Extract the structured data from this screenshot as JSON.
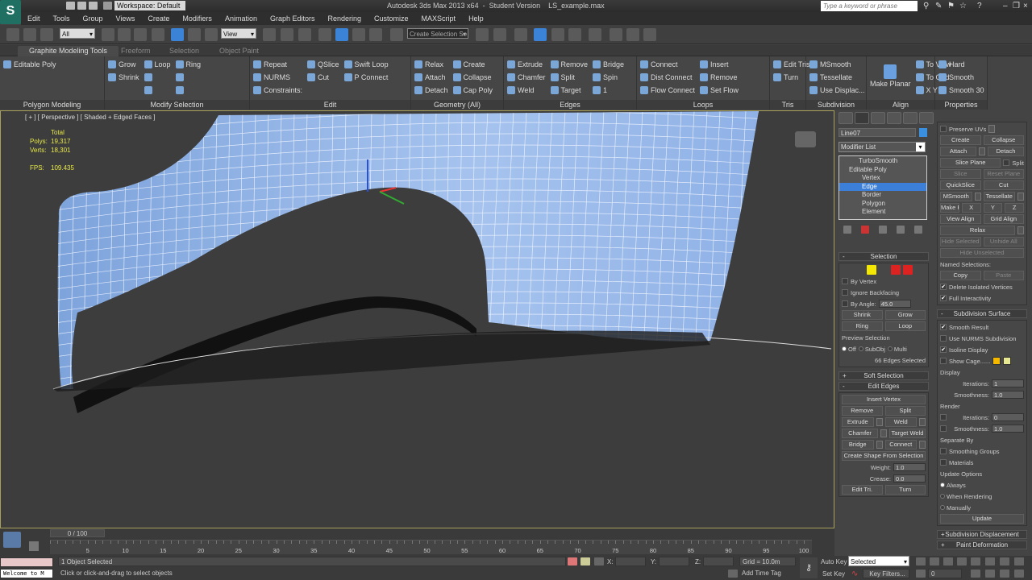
{
  "title": {
    "workspace": "Workspace: Default",
    "app_title": "Autodesk 3ds Max 2013 x64  -  Student Version    LS_example.max",
    "search_placeholder": "Type a keyword or phrase"
  },
  "menu": [
    "Edit",
    "Tools",
    "Group",
    "Views",
    "Create",
    "Modifiers",
    "Animation",
    "Graph Editors",
    "Rendering",
    "Customize",
    "MAXScript",
    "Help"
  ],
  "toolbar": {
    "selection_filter": "All",
    "ref_coord": "View",
    "named_selection": "Create Selection Se"
  },
  "ribbon_tabs": [
    {
      "label": "Graphite Modeling Tools",
      "active": true
    },
    {
      "label": "Freeform",
      "active": false
    },
    {
      "label": "Selection",
      "active": false
    },
    {
      "label": "Object Paint",
      "active": false
    }
  ],
  "ribbon_groups": [
    {
      "label": "Polygon Modeling",
      "cols": [
        [
          {
            "label": "Editable Poly"
          }
        ]
      ]
    },
    {
      "label": "Modify Selection",
      "cols": [
        [
          {
            "label": "Grow"
          },
          {
            "label": "Shrink"
          }
        ],
        [
          {
            "label": "Loop"
          },
          {
            "label": ""
          },
          {
            "label": ""
          }
        ],
        [
          {
            "label": "Ring"
          },
          {
            "label": ""
          },
          {
            "label": ""
          }
        ]
      ]
    },
    {
      "label": "Edit",
      "cols": [
        [
          {
            "label": "Repeat"
          },
          {
            "label": "NURMS"
          },
          {
            "label": "Constraints:"
          }
        ],
        [
          {
            "label": "QSlice"
          },
          {
            "label": "Cut"
          }
        ],
        [
          {
            "label": "Swift Loop"
          },
          {
            "label": "P Connect"
          }
        ]
      ]
    },
    {
      "label": "Geometry (All)",
      "cols": [
        [
          {
            "label": "Relax"
          },
          {
            "label": "Attach"
          },
          {
            "label": "Detach"
          }
        ],
        [
          {
            "label": "Create"
          },
          {
            "label": "Collapse"
          },
          {
            "label": "Cap Poly"
          }
        ]
      ]
    },
    {
      "label": "Edges",
      "cols": [
        [
          {
            "label": "Extrude"
          },
          {
            "label": "Chamfer"
          },
          {
            "label": "Weld"
          }
        ],
        [
          {
            "label": "Remove"
          },
          {
            "label": "Split"
          },
          {
            "label": "Target"
          }
        ],
        [
          {
            "label": "Bridge"
          },
          {
            "label": "Spin"
          },
          {
            "label": "1"
          }
        ]
      ]
    },
    {
      "label": "Loops",
      "cols": [
        [
          {
            "label": "Connect"
          },
          {
            "label": "Dist Connect"
          },
          {
            "label": "Flow Connect"
          }
        ],
        [
          {
            "label": "Insert"
          },
          {
            "label": "Remove"
          },
          {
            "label": "Set Flow"
          }
        ]
      ]
    },
    {
      "label": "Tris",
      "cols": [
        [
          {
            "label": "Edit Tris"
          },
          {
            "label": "Turn"
          }
        ]
      ]
    },
    {
      "label": "Subdivision",
      "cols": [
        [
          {
            "label": "MSmooth"
          },
          {
            "label": "Tessellate"
          },
          {
            "label": "Use Displac..."
          }
        ]
      ]
    },
    {
      "label": "Align",
      "cols": [
        [
          {
            "label": "Make Planar",
            "big": true
          }
        ],
        [
          {
            "label": "To View"
          },
          {
            "label": "To Grid"
          },
          {
            "label": "X  Y  Z"
          }
        ]
      ]
    },
    {
      "label": "Properties",
      "cols": [
        [
          {
            "label": "Hard"
          },
          {
            "label": "Smooth"
          },
          {
            "label": "Smooth 30"
          }
        ]
      ]
    }
  ],
  "viewport": {
    "label": "[ + ] [ Perspective ] [ Shaded + Edged Faces ]",
    "stats": {
      "total_label": "Total",
      "polys_label": "Polys:",
      "polys": "19,317",
      "verts_label": "Verts:",
      "verts": "18,301",
      "fps_label": "FPS:",
      "fps": "109.435"
    },
    "mesh_color": "#8fb1e6"
  },
  "command_panel": {
    "object_name": "Line07",
    "object_color": "#3b8fdf",
    "modifier_list": "Modifier List",
    "stack": [
      {
        "label": "TurboSmooth",
        "level": 0,
        "selected": false
      },
      {
        "label": "Editable Poly",
        "level": 0,
        "selected": false
      },
      {
        "label": "Vertex",
        "level": 1,
        "selected": false
      },
      {
        "label": "Edge",
        "level": 1,
        "selected": true
      },
      {
        "label": "Border",
        "level": 1,
        "selected": false
      },
      {
        "label": "Polygon",
        "level": 1,
        "selected": false
      },
      {
        "label": "Element",
        "level": 1,
        "selected": false
      }
    ],
    "left": [
      {
        "header": "Selection",
        "pm": "-",
        "rows": [
          [
            {
              "t": "icons"
            }
          ],
          [
            {
              "t": "chk",
              "label": "By Vertex",
              "checked": false
            }
          ],
          [
            {
              "t": "chk",
              "label": "Ignore Backfacing",
              "checked": false
            }
          ],
          [
            {
              "t": "chk",
              "label": "By Angle:",
              "checked": false
            },
            {
              "t": "spin",
              "value": "45.0"
            }
          ],
          [
            {
              "t": "btn",
              "label": "Shrink"
            },
            {
              "t": "btn",
              "label": "Grow"
            }
          ],
          [
            {
              "t": "btn",
              "label": "Ring"
            },
            {
              "t": "btn",
              "label": "Loop"
            }
          ],
          [
            {
              "t": "lbl",
              "label": "Preview Selection"
            }
          ],
          [
            {
              "t": "radio",
              "label": "Off",
              "on": true
            },
            {
              "t": "radio",
              "label": "SubObj",
              "on": false
            },
            {
              "t": "radio",
              "label": "Multi",
              "on": false
            }
          ],
          [
            {
              "t": "lblr",
              "label": "66 Edges Selected"
            }
          ]
        ]
      },
      {
        "header": "Soft Selection",
        "pm": "+",
        "rows": []
      },
      {
        "header": "Edit Edges",
        "pm": "-",
        "rows": [
          [
            {
              "t": "btn",
              "label": "Insert Vertex"
            }
          ],
          [
            {
              "t": "btn",
              "label": "Remove"
            },
            {
              "t": "btn",
              "label": "Split"
            }
          ],
          [
            {
              "t": "btn",
              "label": "Extrude"
            },
            {
              "t": "opt"
            },
            {
              "t": "btn",
              "label": "Weld"
            },
            {
              "t": "opt"
            }
          ],
          [
            {
              "t": "btn",
              "label": "Chamfer"
            },
            {
              "t": "opt"
            },
            {
              "t": "btn",
              "label": "Target Weld"
            }
          ],
          [
            {
              "t": "btn",
              "label": "Bridge"
            },
            {
              "t": "opt"
            },
            {
              "t": "btn",
              "label": "Connect"
            },
            {
              "t": "opt"
            }
          ],
          [
            {
              "t": "btn",
              "label": "Create Shape From Selection"
            }
          ],
          [
            {
              "t": "lblr",
              "label": "Weight:"
            },
            {
              "t": "spin",
              "value": "1.0"
            }
          ],
          [
            {
              "t": "lblr",
              "label": "Crease:"
            },
            {
              "t": "spin",
              "value": "0.0"
            }
          ],
          [
            {
              "t": "btn",
              "label": "Edit Tri."
            },
            {
              "t": "btn",
              "label": "Turn"
            }
          ]
        ]
      }
    ],
    "right": [
      {
        "header": "",
        "rows": [
          [
            {
              "t": "chk",
              "label": "Preserve UVs",
              "checked": false
            },
            {
              "t": "opt"
            }
          ],
          [
            {
              "t": "btn",
              "label": "Create"
            },
            {
              "t": "btn",
              "label": "Collapse"
            }
          ],
          [
            {
              "t": "btn",
              "label": "Attach"
            },
            {
              "t": "opt"
            },
            {
              "t": "btn",
              "label": "Detach"
            }
          ],
          [
            {
              "t": "btn",
              "label": "Slice Plane"
            },
            {
              "t": "chk",
              "label": "Split",
              "checked": false
            }
          ],
          [
            {
              "t": "btn",
              "label": "Slice",
              "dim": true
            },
            {
              "t": "btn",
              "label": "Reset Plane",
              "dim": true
            }
          ],
          [
            {
              "t": "btn",
              "label": "QuickSlice"
            },
            {
              "t": "btn",
              "label": "Cut"
            }
          ],
          [
            {
              "t": "btn",
              "label": "MSmooth"
            },
            {
              "t": "opt"
            },
            {
              "t": "btn",
              "label": "Tessellate"
            },
            {
              "t": "opt"
            }
          ],
          [
            {
              "t": "btn",
              "label": "Make Planar"
            },
            {
              "t": "btn",
              "label": "X"
            },
            {
              "t": "btn",
              "label": "Y"
            },
            {
              "t": "btn",
              "label": "Z"
            }
          ],
          [
            {
              "t": "btn",
              "label": "View Align"
            },
            {
              "t": "btn",
              "label": "Grid Align"
            }
          ],
          [
            {
              "t": "btn",
              "label": "Relax"
            },
            {
              "t": "opt"
            }
          ],
          [
            {
              "t": "btn",
              "label": "Hide Selected",
              "dim": true
            },
            {
              "t": "btn",
              "label": "Unhide All",
              "dim": true
            }
          ],
          [
            {
              "t": "btn",
              "label": "Hide Unselected",
              "dim": true
            }
          ],
          [
            {
              "t": "lbl",
              "label": "Named Selections:"
            }
          ],
          [
            {
              "t": "btn",
              "label": "Copy"
            },
            {
              "t": "btn",
              "label": "Paste",
              "dim": true
            }
          ],
          [
            {
              "t": "chk",
              "label": "Delete Isolated Vertices",
              "checked": true
            }
          ],
          [
            {
              "t": "chk",
              "label": "Full Interactivity",
              "checked": true
            }
          ]
        ]
      },
      {
        "header": "Subdivision Surface",
        "pm": "-",
        "rows": [
          [
            {
              "t": "chk",
              "label": "Smooth Result",
              "checked": true
            }
          ],
          [
            {
              "t": "chk",
              "label": "Use NURMS Subdivision",
              "checked": false
            }
          ],
          [
            {
              "t": "chk",
              "label": "Isoline Display",
              "checked": true
            }
          ],
          [
            {
              "t": "chk",
              "label": "Show Cage......",
              "checked": false
            },
            {
              "t": "swatch",
              "color": "#f5b800"
            },
            {
              "t": "swatch",
              "color": "#e8e890"
            }
          ],
          [
            {
              "t": "lbl",
              "label": "Display"
            }
          ],
          [
            {
              "t": "lblr",
              "label": "Iterations:"
            },
            {
              "t": "spin",
              "value": "1"
            }
          ],
          [
            {
              "t": "lblr",
              "label": "Smoothness:"
            },
            {
              "t": "spin",
              "value": "1.0"
            }
          ],
          [
            {
              "t": "lbl",
              "label": "Render"
            }
          ],
          [
            {
              "t": "chk",
              "label": "",
              "checked": false
            },
            {
              "t": "lblr",
              "label": "Iterations:"
            },
            {
              "t": "spin",
              "value": "0"
            }
          ],
          [
            {
              "t": "chk",
              "label": "",
              "checked": false
            },
            {
              "t": "lblr",
              "label": "Smoothness:"
            },
            {
              "t": "spin",
              "value": "1.0"
            }
          ],
          [
            {
              "t": "lbl",
              "label": "Separate By"
            }
          ],
          [
            {
              "t": "chk",
              "label": "Smoothing Groups",
              "checked": false
            }
          ],
          [
            {
              "t": "chk",
              "label": "Materials",
              "checked": false
            }
          ],
          [
            {
              "t": "lbl",
              "label": "Update Options"
            }
          ],
          [
            {
              "t": "radio",
              "label": "Always",
              "on": true
            }
          ],
          [
            {
              "t": "radio",
              "label": "When Rendering",
              "on": false
            }
          ],
          [
            {
              "t": "radio",
              "label": "Manually",
              "on": false
            }
          ],
          [
            {
              "t": "btn",
              "label": "Update"
            }
          ]
        ]
      },
      {
        "header": "Subdivision Displacement",
        "pm": "+",
        "rows": []
      },
      {
        "header": "Paint Deformation",
        "pm": "+",
        "rows": []
      }
    ]
  },
  "timeline": {
    "slider": "0 / 100",
    "ticks": [
      5,
      10,
      15,
      20,
      25,
      30,
      35,
      40,
      45,
      50,
      55,
      60,
      65,
      70,
      75,
      80,
      85,
      90,
      95,
      100
    ],
    "max": 100
  },
  "status": {
    "listener": "Welcome to M",
    "selection": "1 Object Selected",
    "prompt": "Click or click-and-drag to select objects",
    "x_label": "X:",
    "y_label": "Y:",
    "z_label": "Z:",
    "grid": "Grid = 10.0m",
    "add_time_tag": "Add Time Tag",
    "auto_key": "Auto Key",
    "set_key": "Set Key",
    "key_mode": "Selected",
    "key_filters": "Key Filters...",
    "frame": "0"
  }
}
